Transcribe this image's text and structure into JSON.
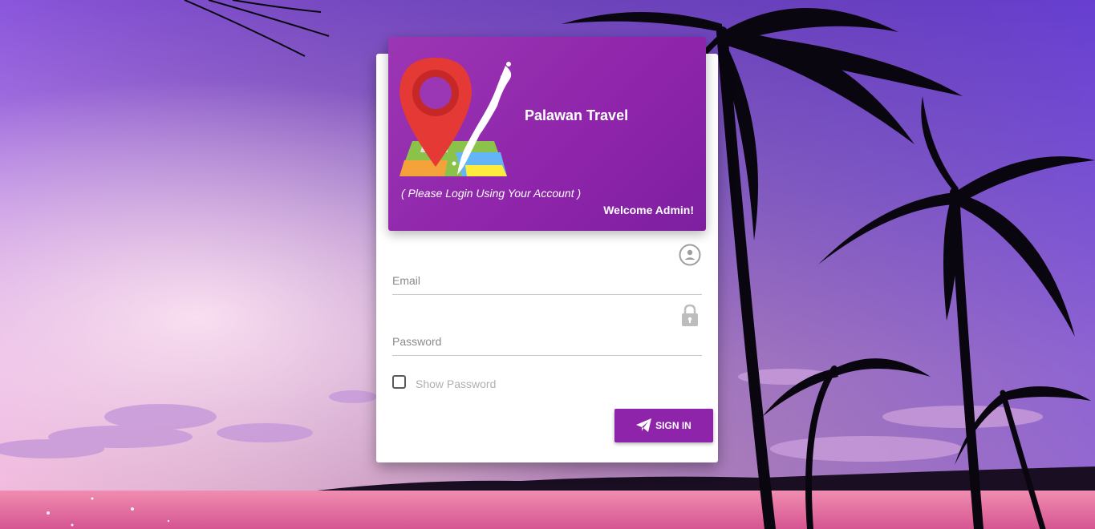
{
  "header": {
    "brand_title": "Palawan Travel",
    "subtitle": "( Please Login Using Your Account )",
    "welcome": "Welcome Admin!"
  },
  "form": {
    "email": {
      "placeholder": "Email",
      "value": "",
      "icon": "account-circle-icon"
    },
    "password": {
      "placeholder": "Password",
      "value": "",
      "icon": "lock-icon"
    },
    "show_password": {
      "label": "Show Password",
      "checked": false
    },
    "signin": {
      "label": "SIGN IN",
      "icon": "paper-plane-icon"
    }
  },
  "colors": {
    "primary": "#8e24aa",
    "sky_top": "#6a3fd4",
    "sky_bottom": "#e9a3d8",
    "sea": "#e0608f"
  }
}
